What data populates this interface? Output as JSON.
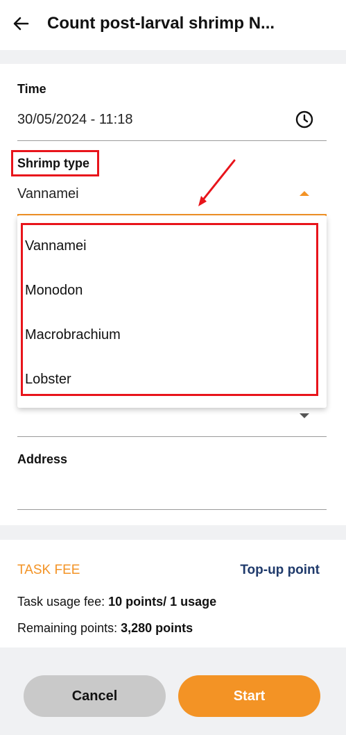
{
  "header": {
    "title": "Count post-larval shrimp N..."
  },
  "form": {
    "time_label": "Time",
    "time_value": "30/05/2024 - 11:18",
    "shrimp_type_label": "Shrimp type",
    "shrimp_type_value": "Vannamei",
    "dropdown_options": [
      "Vannamei",
      "Monodon",
      "Macrobrachium",
      "Lobster"
    ],
    "address_label": "Address",
    "address_value": ""
  },
  "fee": {
    "title": "TASK FEE",
    "topup_label": "Top-up point",
    "usage_label": "Task usage fee:",
    "usage_value": "10 points/ 1 usage",
    "remaining_label": "Remaining points:",
    "remaining_value": "3,280 points"
  },
  "actions": {
    "cancel_label": "Cancel",
    "start_label": "Start"
  },
  "colors": {
    "accent": "#f39325",
    "highlight": "#e8141b",
    "link": "#1f3a6b"
  }
}
